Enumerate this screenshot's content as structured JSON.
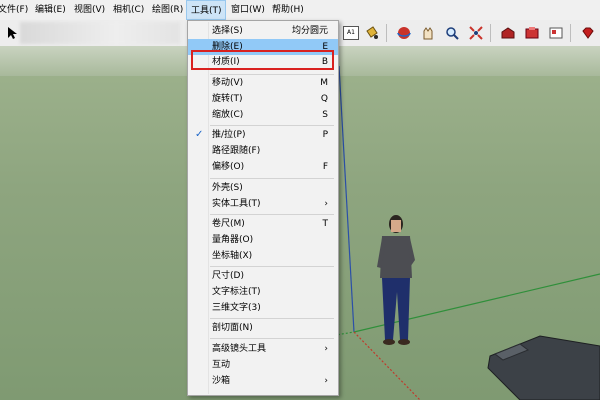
{
  "menubar": {
    "items": [
      {
        "label": "文件(F)"
      },
      {
        "label": "编辑(E)"
      },
      {
        "label": "视图(V)"
      },
      {
        "label": "相机(C)"
      },
      {
        "label": "绘图(R)"
      },
      {
        "label": "工具(T)"
      },
      {
        "label": "窗口(W)"
      },
      {
        "label": "帮助(H)"
      }
    ]
  },
  "toolbar": {
    "icons": [
      "select-icon",
      "text-tool-icon",
      "paint-bucket-icon",
      "orbit-icon",
      "pan-icon",
      "zoom-icon",
      "zoom-extents-icon",
      "warehouse-icon",
      "extension-icon",
      "model-info-icon",
      "ruby-icon"
    ],
    "text_icon_label": "A1"
  },
  "tools_menu": {
    "items": [
      {
        "label": "选择(S)",
        "shortcut": "均分圆元"
      },
      {
        "label": "删除(E)",
        "shortcut": "E",
        "highlighted": true
      },
      {
        "label": "材质(I)",
        "shortcut": "B"
      },
      {
        "label": "移动(V)",
        "shortcut": "M"
      },
      {
        "label": "旋转(T)",
        "shortcut": "Q"
      },
      {
        "label": "缩放(C)",
        "shortcut": "S"
      },
      {
        "label": "推/拉(P)",
        "shortcut": "P",
        "checked": true
      },
      {
        "label": "路径跟随(F)",
        "shortcut": ""
      },
      {
        "label": "偏移(O)",
        "shortcut": "F"
      },
      {
        "label": "外壳(S)",
        "shortcut": ""
      },
      {
        "label": "实体工具(T)",
        "submenu": true
      },
      {
        "label": "卷尺(M)",
        "shortcut": "T"
      },
      {
        "label": "量角器(O)",
        "shortcut": ""
      },
      {
        "label": "坐标轴(X)",
        "shortcut": ""
      },
      {
        "label": "尺寸(D)",
        "shortcut": ""
      },
      {
        "label": "文字标注(T)",
        "shortcut": ""
      },
      {
        "label": "三维文字(3)",
        "shortcut": ""
      },
      {
        "label": "剖切面(N)",
        "shortcut": ""
      },
      {
        "label": "高级镜头工具",
        "submenu": true
      },
      {
        "label": "互动",
        "shortcut": ""
      },
      {
        "label": "沙箱",
        "submenu": true
      }
    ],
    "submenu_arrow": "›",
    "check_mark": "✓"
  },
  "colors": {
    "callout": "#d9211f",
    "highlight": "#91c9f7",
    "axis_green": "#2f8f3a",
    "axis_red": "#c0392b",
    "axis_blue": "#2b4fa8"
  }
}
